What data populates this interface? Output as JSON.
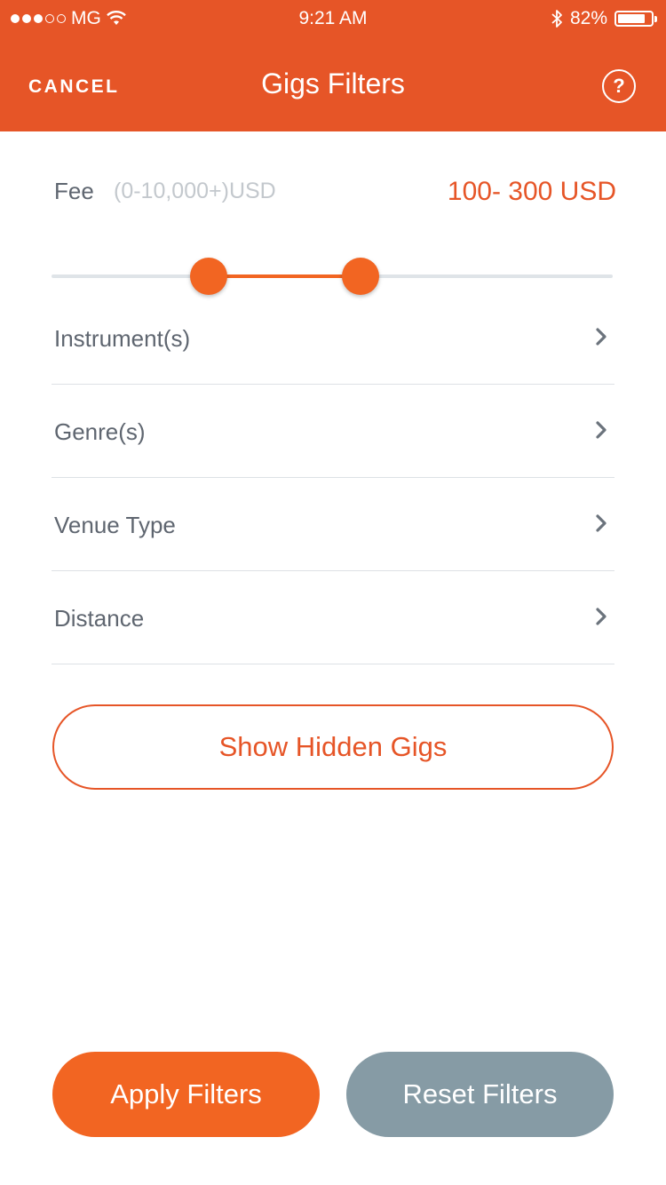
{
  "status_bar": {
    "carrier": "MG",
    "signal_bars_filled": 3,
    "signal_bars_total": 5,
    "time": "9:21 AM",
    "battery": "82%",
    "battery_level": 0.82,
    "icons": [
      "wifi-icon",
      "bluetooth-icon",
      "battery-icon"
    ]
  },
  "nav": {
    "cancel_label": "CANCEL",
    "title": "Gigs Filters",
    "help_icon": "help-icon",
    "help_glyph": "?"
  },
  "fee": {
    "label": "Fee",
    "range_hint": "(0-10,000+)USD",
    "selected_value": "100- 300 USD",
    "slider": {
      "min": 0,
      "max": 10000,
      "low_fraction": 0.28,
      "high_fraction": 0.55
    }
  },
  "filters": [
    {
      "label": "Instrument(s)"
    },
    {
      "label": "Genre(s)"
    },
    {
      "label": "Venue Type"
    },
    {
      "label": "Distance"
    }
  ],
  "hidden_gigs_label": "Show Hidden Gigs",
  "actions": {
    "apply_label": "Apply Filters",
    "reset_label": "Reset Filters"
  },
  "colors": {
    "brand": "#e65527",
    "accent": "#f26522",
    "reset": "#869ba5",
    "text": "#5f6670",
    "hint": "#c3c8cd"
  }
}
